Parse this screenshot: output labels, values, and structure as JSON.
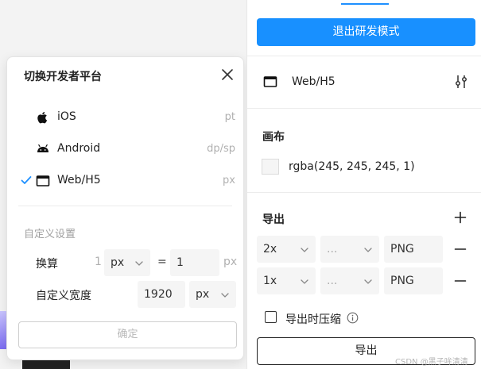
{
  "popup": {
    "title": "切换开发者平台",
    "platforms": [
      {
        "label": "iOS",
        "unit": "pt",
        "icon": "apple-icon",
        "selected": false
      },
      {
        "label": "Android",
        "unit": "dp/sp",
        "icon": "android-icon",
        "selected": false
      },
      {
        "label": "Web/H5",
        "unit": "px",
        "icon": "browser-window-icon",
        "selected": true
      }
    ],
    "custom_settings_title": "自定义设置",
    "conversion_label": "换算",
    "conversion_from_value": "1",
    "conversion_from_unit": "px",
    "equals": "=",
    "conversion_to_value": "1",
    "conversion_to_unit": "px",
    "custom_width_label": "自定义宽度",
    "custom_width_value": "1920",
    "custom_width_unit": "px",
    "confirm_label": "确定"
  },
  "panel": {
    "exit_button_label": "退出研发模式",
    "platform_label": "Web/H5",
    "canvas_title": "画布",
    "canvas_color": "rgba(245, 245, 245, 1)",
    "export_title": "导出",
    "export_rows": [
      {
        "scale": "2x",
        "suffix": "...",
        "format": "PNG"
      },
      {
        "scale": "1x",
        "suffix": "...",
        "format": "PNG"
      }
    ],
    "compress_label": "导出时压缩",
    "export_button_label": "导出"
  },
  "watermark": "CSDN @黑子哞清清",
  "colors": {
    "accent": "#1890ff",
    "check": "#1e90ff"
  }
}
